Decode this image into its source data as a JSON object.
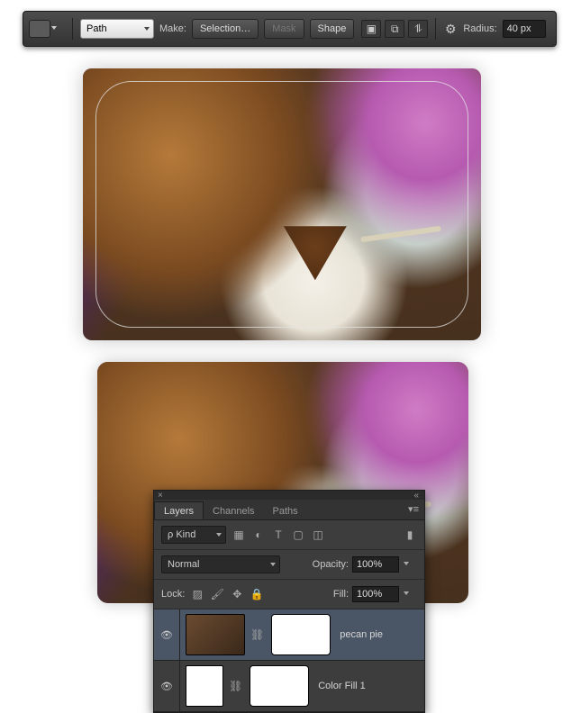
{
  "options_bar": {
    "mode_label": "Path",
    "make_label": "Make:",
    "selection_btn": "Selection…",
    "mask_btn": "Mask",
    "shape_btn": "Shape",
    "radius_label": "Radius:",
    "radius_value": "40 px"
  },
  "layers_panel": {
    "tabs": {
      "layers": "Layers",
      "channels": "Channels",
      "paths": "Paths"
    },
    "kind_label": "Kind",
    "blend_mode": "Normal",
    "opacity_label": "Opacity:",
    "opacity_value": "100%",
    "lock_label": "Lock:",
    "fill_label": "Fill:",
    "fill_value": "100%",
    "layers": [
      {
        "name": "pecan pie"
      },
      {
        "name": "Color Fill 1"
      }
    ]
  }
}
